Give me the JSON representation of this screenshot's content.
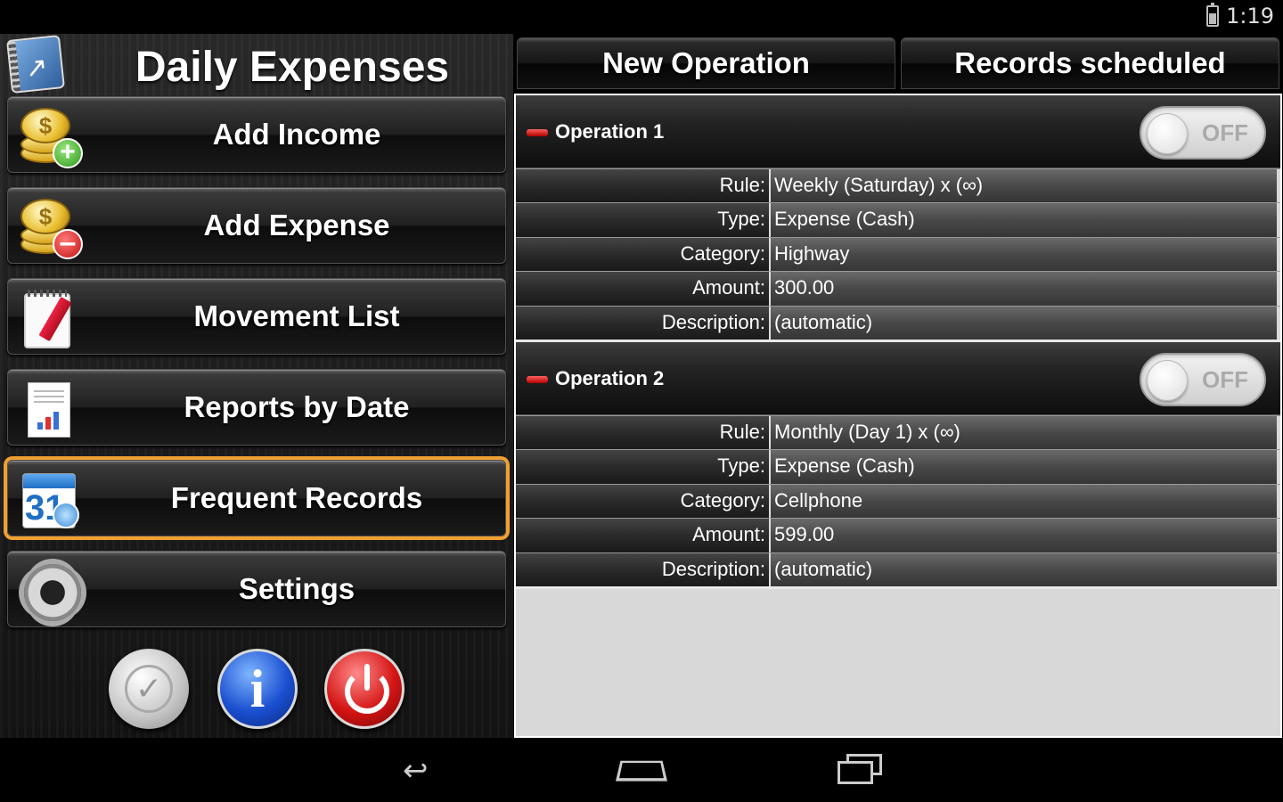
{
  "status_bar": {
    "time": "1:19",
    "battery_icon": "battery-icon"
  },
  "app": {
    "title": "Daily Expenses",
    "logo_icon": "app-logo-icon"
  },
  "menu": {
    "items": [
      {
        "label": "Add Income",
        "icon": "coins-plus-icon"
      },
      {
        "label": "Add Expense",
        "icon": "coins-minus-icon"
      },
      {
        "label": "Movement List",
        "icon": "notepad-icon"
      },
      {
        "label": "Reports by Date",
        "icon": "report-icon"
      },
      {
        "label": "Frequent Records",
        "icon": "calendar-clock-icon",
        "selected": true
      },
      {
        "label": "Settings",
        "icon": "gear-icon"
      }
    ],
    "selected_color": "#f0a030"
  },
  "bottom_buttons": [
    {
      "name": "check",
      "icon": "check-seal-icon"
    },
    {
      "name": "info",
      "icon": "info-icon"
    },
    {
      "name": "power",
      "icon": "power-icon"
    }
  ],
  "tabs": {
    "new_operation": "New Operation",
    "records_scheduled": "Records scheduled"
  },
  "operations": [
    {
      "title": "Operation 1",
      "toggle": "OFF",
      "rows": [
        {
          "label": "Rule:",
          "value": "Weekly (Saturday) x (∞)"
        },
        {
          "label": "Type:",
          "value": "Expense (Cash)"
        },
        {
          "label": "Category:",
          "value": "Highway"
        },
        {
          "label": "Amount:",
          "value": "300.00"
        },
        {
          "label": "Description:",
          "value": "(automatic)"
        }
      ]
    },
    {
      "title": "Operation 2",
      "toggle": "OFF",
      "rows": [
        {
          "label": "Rule:",
          "value": "Monthly (Day 1) x (∞)"
        },
        {
          "label": "Type:",
          "value": "Expense (Cash)"
        },
        {
          "label": "Category:",
          "value": "Cellphone"
        },
        {
          "label": "Amount:",
          "value": "599.00"
        },
        {
          "label": "Description:",
          "value": "(automatic)"
        }
      ]
    }
  ],
  "nav": {
    "back_icon": "back-icon",
    "home_icon": "home-icon",
    "recents_icon": "recents-icon"
  }
}
